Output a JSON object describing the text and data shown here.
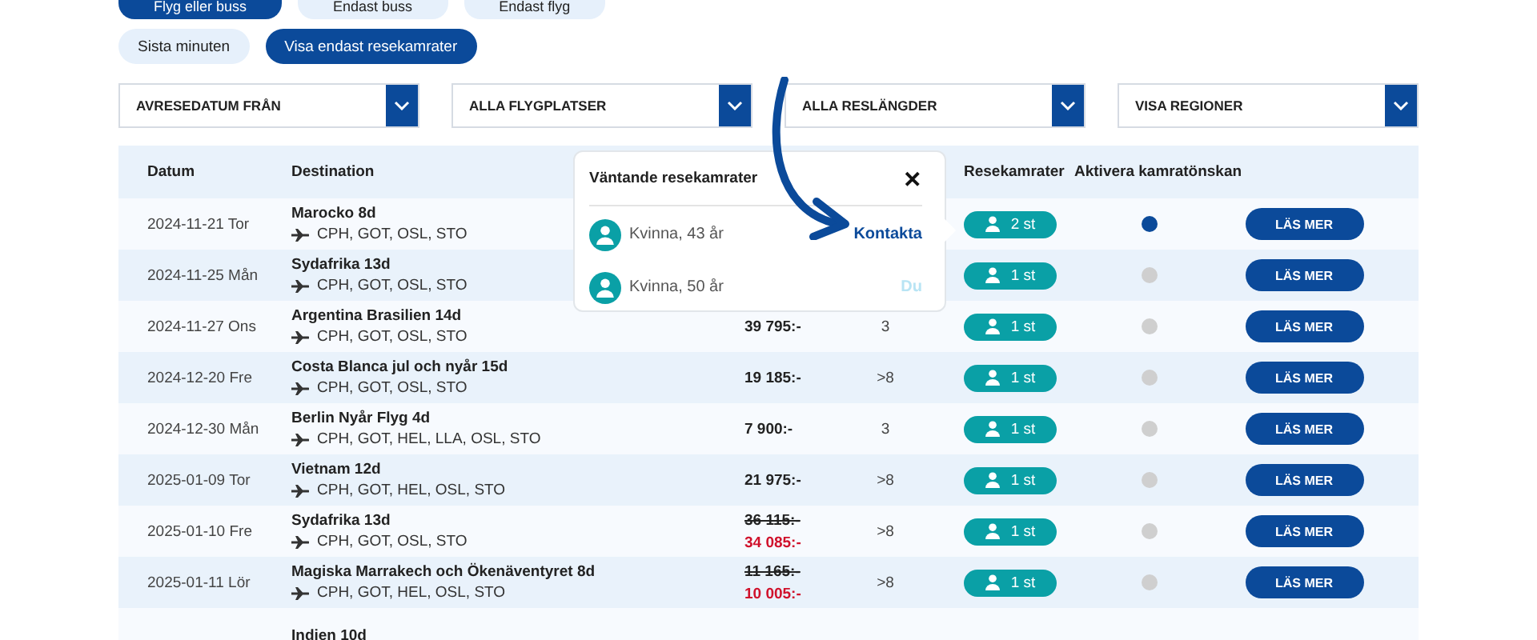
{
  "transport_filters": [
    {
      "label": "Flyg eller buss",
      "selected": true
    },
    {
      "label": "Endast buss",
      "selected": false
    },
    {
      "label": "Endast flyg",
      "selected": false
    }
  ],
  "quick_filters": [
    {
      "label": "Sista minuten",
      "selected": false
    },
    {
      "label": "Visa endast resekamrater",
      "selected": true
    }
  ],
  "dropdowns": [
    "AVRESEDATUM FRÅN",
    "ALLA FLYGPLATSER",
    "ALLA RESLÄNGDER",
    "VISA REGIONER"
  ],
  "table": {
    "columns": [
      "Datum",
      "Destination",
      "",
      "",
      "Resekamrater",
      "Aktivera kamratönskan",
      ""
    ],
    "rows": [
      {
        "date": "2024-11-21 Tor",
        "destination": "Marocko 8d",
        "airports": "CPH, GOT, OSL, STO",
        "price": "",
        "places": "",
        "companions": "2 st",
        "wish_active": true,
        "button": "LÄS MER"
      },
      {
        "date": "2024-11-25 Mån",
        "destination": "Sydafrika 13d",
        "airports": "CPH, GOT, OSL, STO",
        "price": "",
        "places": "",
        "companions": "1 st",
        "wish_active": false,
        "button": "LÄS MER"
      },
      {
        "date": "2024-11-27 Ons",
        "destination": "Argentina Brasilien 14d",
        "airports": "CPH, GOT, OSL, STO",
        "price": "39 795:-",
        "places": "3",
        "companions": "1 st",
        "wish_active": false,
        "button": "LÄS MER"
      },
      {
        "date": "2024-12-20 Fre",
        "destination": "Costa Blanca jul och nyår 15d",
        "airports": "CPH, GOT, OSL, STO",
        "price": "19 185:-",
        "places": ">8",
        "companions": "1 st",
        "wish_active": false,
        "button": "LÄS MER"
      },
      {
        "date": "2024-12-30 Mån",
        "destination": "Berlin Nyår Flyg 4d",
        "airports": "CPH, GOT, HEL, LLA, OSL, STO",
        "price": "7 900:-",
        "places": "3",
        "companions": "1 st",
        "wish_active": false,
        "button": "LÄS MER"
      },
      {
        "date": "2025-01-09 Tor",
        "destination": "Vietnam 12d",
        "airports": "CPH, GOT, HEL, OSL, STO",
        "price": "21 975:-",
        "places": ">8",
        "companions": "1 st",
        "wish_active": false,
        "button": "LÄS MER"
      },
      {
        "date": "2025-01-10 Fre",
        "destination": "Sydafrika 13d",
        "airports": "CPH, GOT, OSL, STO",
        "old_price": "36 115:-",
        "price": "34 085:-",
        "places": ">8",
        "companions": "1 st",
        "wish_active": false,
        "button": "LÄS MER"
      },
      {
        "date": "2025-01-11 Lör",
        "destination": "Magiska Marrakech och Ökenäventyret 8d",
        "airports": "CPH, GOT, HEL, OSL, STO",
        "old_price": "11 165:-",
        "price": "10 005:-",
        "places": ">8",
        "companions": "1 st",
        "wish_active": false,
        "button": "LÄS MER"
      },
      {
        "destination": "Indien 10d"
      }
    ]
  },
  "popup": {
    "title": "Väntande resekamrater",
    "close": "✕",
    "items": [
      {
        "label": "Kvinna,  43 år",
        "action": "Kontakta",
        "kind": "contact"
      },
      {
        "label": "Kvinna,  50 år",
        "action": "Du",
        "kind": "self"
      }
    ]
  }
}
